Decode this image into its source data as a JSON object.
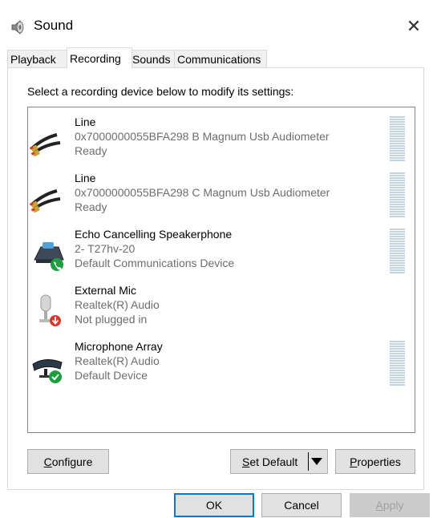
{
  "window": {
    "title": "Sound",
    "close_glyph": "✕",
    "icon": "speaker-icon"
  },
  "tabs": [
    {
      "label": "Playback",
      "active": false
    },
    {
      "label": "Recording",
      "active": true
    },
    {
      "label": "Sounds",
      "active": false
    },
    {
      "label": "Communications",
      "active": false
    }
  ],
  "panel": {
    "instruction": "Select a recording device below to modify its settings:"
  },
  "devices": [
    {
      "name": "Line",
      "desc": "0x7000000055BFA298 B Magnum Usb Audiometer",
      "status": "Ready",
      "icon": "line-cable-icon",
      "level_meter": true
    },
    {
      "name": "Line",
      "desc": "0x7000000055BFA298 C Magnum Usb Audiometer",
      "status": "Ready",
      "icon": "line-cable-icon",
      "level_meter": true
    },
    {
      "name": "Echo Cancelling Speakerphone",
      "desc": "2- T27hv-20",
      "status": "Default Communications Device",
      "icon": "speakerphone-icon",
      "badge": "green-phone-badge",
      "level_meter": true
    },
    {
      "name": "External Mic",
      "desc": "Realtek(R) Audio",
      "status": "Not plugged in",
      "icon": "microphone-icon",
      "badge": "red-down-arrow-badge",
      "level_meter": false
    },
    {
      "name": "Microphone Array",
      "desc": "Realtek(R) Audio",
      "status": "Default Device",
      "icon": "microphone-array-icon",
      "badge": "green-check-badge",
      "level_meter": true
    }
  ],
  "buttons": {
    "configure": {
      "mnemonic": "C",
      "rest": "onfigure"
    },
    "set_default": {
      "mnemonic": "S",
      "rest": "et Default"
    },
    "properties": {
      "mnemonic": "P",
      "rest": "roperties"
    },
    "ok": "OK",
    "cancel": "Cancel",
    "apply": {
      "mnemonic": "A",
      "rest": "pply",
      "disabled": true
    }
  },
  "colors": {
    "accent": "#0078d7",
    "meter": "#c2d4e2",
    "secondary_text": "#6d6d6d",
    "ok_badge": "#1e9e3e",
    "unplugged_badge": "#d9362b"
  }
}
